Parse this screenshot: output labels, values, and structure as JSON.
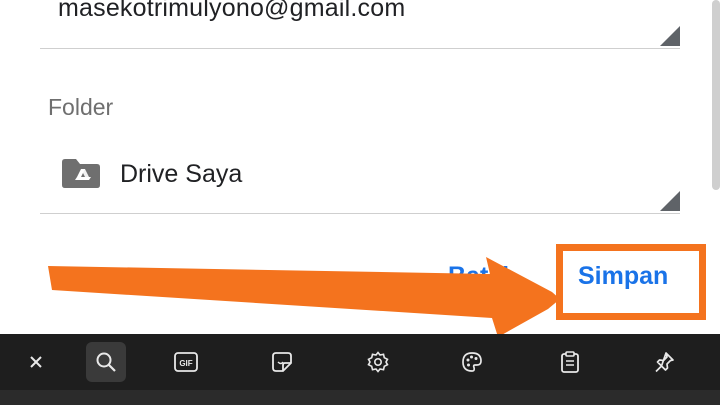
{
  "account": {
    "email": "masekotrimulyono@gmail.com"
  },
  "folder": {
    "label": "Folder",
    "value": "Drive Saya"
  },
  "actions": {
    "cancel_label": "Batal",
    "save_label": "Simpan"
  },
  "colors": {
    "accent": "#1a73e8",
    "highlight": "#f4731e",
    "keyboard_bg": "#1e1e1e"
  },
  "keyboard_toolbar": {
    "icons": [
      "close-icon",
      "search-icon",
      "gif-icon",
      "sticker-icon",
      "settings-icon",
      "palette-icon",
      "clipboard-icon",
      "pin-icon"
    ],
    "gif_text": "GIF"
  }
}
